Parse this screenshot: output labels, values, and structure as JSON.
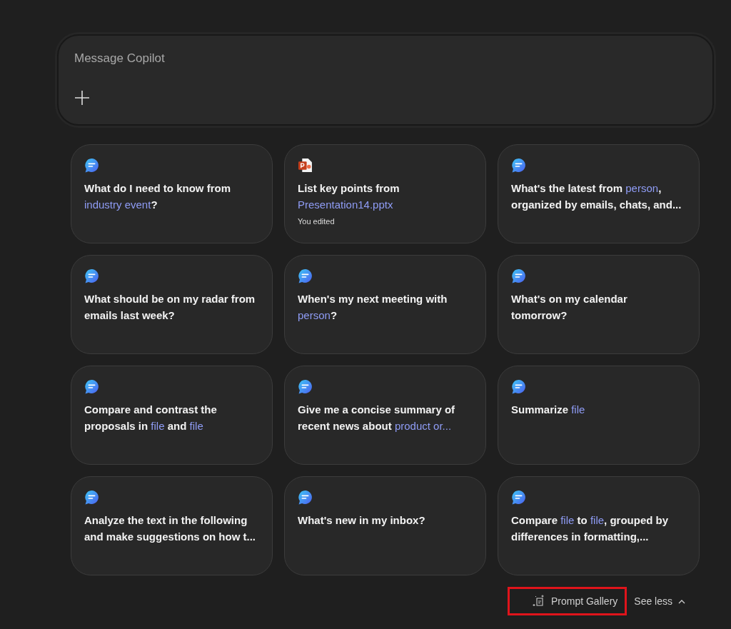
{
  "composer": {
    "placeholder": "Message Copilot"
  },
  "cards": [
    {
      "kind": "chat",
      "segments": [
        {
          "text": "What do I need to know from "
        },
        {
          "text": "industry event",
          "slot": true
        },
        {
          "text": "?"
        }
      ]
    },
    {
      "kind": "pptx",
      "segments": [
        {
          "text": "List key points from "
        },
        {
          "text": "Presentation14.pptx",
          "slot": true
        }
      ],
      "note": "You edited"
    },
    {
      "kind": "chat",
      "segments": [
        {
          "text": "What's the latest from "
        },
        {
          "text": "person",
          "slot": true
        },
        {
          "text": ", organized by emails, chats, and..."
        }
      ]
    },
    {
      "kind": "chat",
      "segments": [
        {
          "text": "What should be on my radar from emails last week?"
        }
      ]
    },
    {
      "kind": "chat",
      "segments": [
        {
          "text": "When's my next meeting with "
        },
        {
          "text": "person",
          "slot": true
        },
        {
          "text": "?"
        }
      ]
    },
    {
      "kind": "chat",
      "segments": [
        {
          "text": "What's on my calendar tomorrow?"
        }
      ]
    },
    {
      "kind": "chat",
      "segments": [
        {
          "text": "Compare and contrast the proposals in "
        },
        {
          "text": "file",
          "slot": true
        },
        {
          "text": " and "
        },
        {
          "text": "file",
          "slot": true
        }
      ]
    },
    {
      "kind": "chat",
      "segments": [
        {
          "text": "Give me a concise summary of recent news about "
        },
        {
          "text": "product or...",
          "slot": true
        }
      ]
    },
    {
      "kind": "chat",
      "segments": [
        {
          "text": "Summarize "
        },
        {
          "text": "file",
          "slot": true
        }
      ]
    },
    {
      "kind": "chat",
      "segments": [
        {
          "text": "Analyze the text in the following and make suggestions on how t..."
        }
      ]
    },
    {
      "kind": "chat",
      "segments": [
        {
          "text": "What's new in my inbox?"
        }
      ]
    },
    {
      "kind": "chat",
      "segments": [
        {
          "text": "Compare "
        },
        {
          "text": "file",
          "slot": true
        },
        {
          "text": " to "
        },
        {
          "text": "file",
          "slot": true
        },
        {
          "text": ", grouped by differences in formatting,..."
        }
      ]
    }
  ],
  "footer": {
    "gallery": {
      "label": "Prompt Gallery",
      "highlighted": true
    },
    "toggle": {
      "label": "See less",
      "expanded": true
    }
  }
}
